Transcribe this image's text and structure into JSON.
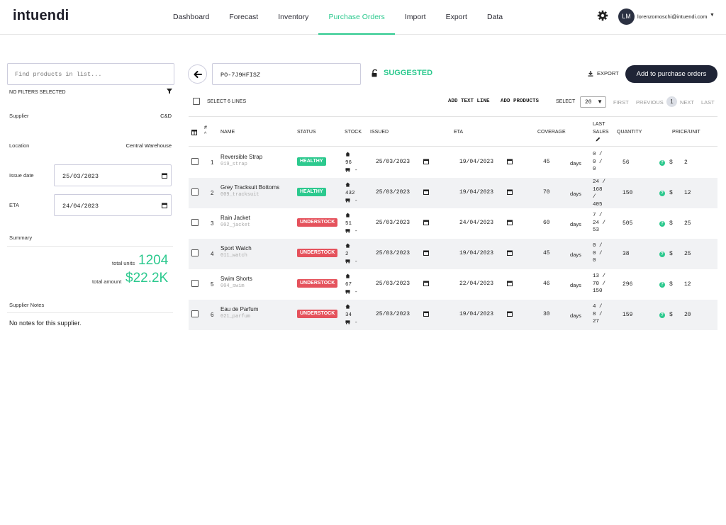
{
  "app": {
    "logo": "intuendi"
  },
  "nav": {
    "items": [
      {
        "label": "Dashboard"
      },
      {
        "label": "Forecast"
      },
      {
        "label": "Inventory"
      },
      {
        "label": "Purchase Orders",
        "active": true
      },
      {
        "label": "Import"
      },
      {
        "label": "Export"
      },
      {
        "label": "Data"
      }
    ]
  },
  "user": {
    "initials": "LM",
    "email": "lorenzomoschi@intuendi.com"
  },
  "left": {
    "find_placeholder": "Find products in list...",
    "filters_label": "NO FILTERS SELECTED",
    "supplier_label": "Supplier",
    "supplier_value": "C&D",
    "location_label": "Location",
    "location_value": "Central Warehouse",
    "issue_label": "Issue date",
    "issue_value": "25/03/2023",
    "eta_label": "ETA",
    "eta_value": "24/04/2023",
    "summary_label": "Summary",
    "total_units_label": "total units",
    "total_units_value": "1204",
    "total_amount_label": "total amount",
    "total_amount_value": "$22.2K",
    "notes_label": "Supplier Notes",
    "notes_value": "No notes for this supplier."
  },
  "header": {
    "po_value": "PO-7J9HFISZ",
    "status": "SUGGESTED",
    "export_label": "EXPORT",
    "add_button": "Add to purchase orders"
  },
  "toolbar": {
    "select_lines": "SELECT 6 LINES",
    "add_text_line": "ADD TEXT LINE",
    "add_products": "ADD PRODUCTS",
    "select_label": "SELECT",
    "page_size": "20",
    "first": "FIRST",
    "previous": "PREVIOUS",
    "page": "1",
    "next": "NEXT",
    "last": "LAST"
  },
  "table": {
    "headers": {
      "num": "#",
      "name": "NAME",
      "status": "STATUS",
      "stock": "STOCK",
      "issued": "ISSUED",
      "eta": "ETA",
      "coverage": "COVERAGE",
      "last_sales_1": "LAST",
      "last_sales_2": "SALES",
      "quantity": "QUANTITY",
      "price": "PRICE/UNIT"
    },
    "days_label": "days",
    "currency": "$",
    "rows": [
      {
        "n": "1",
        "name": "Reversible Strap",
        "sku": "019_strap",
        "status": "HEALTHY",
        "stock": "96",
        "incoming": "-",
        "issued": "25/03/2023",
        "eta": "19/04/2023",
        "coverage": "45",
        "sales": [
          "0 /",
          "0 /",
          "0"
        ],
        "qty": "56",
        "price": "2"
      },
      {
        "n": "2",
        "name": "Grey Tracksuit Bottoms",
        "sku": "009_tracksuit",
        "status": "HEALTHY",
        "stock": "432",
        "incoming": "-",
        "issued": "25/03/2023",
        "eta": "19/04/2023",
        "coverage": "70",
        "sales": [
          "24 /",
          "168",
          "/",
          "405"
        ],
        "qty": "150",
        "price": "12"
      },
      {
        "n": "3",
        "name": "Rain Jacket",
        "sku": "002_jacket",
        "status": "UNDERSTOCK",
        "stock": "51",
        "incoming": "-",
        "issued": "25/03/2023",
        "eta": "24/04/2023",
        "coverage": "60",
        "sales": [
          "7 /",
          "24 /",
          "53"
        ],
        "qty": "505",
        "price": "25"
      },
      {
        "n": "4",
        "name": "Sport Watch",
        "sku": "011_watch",
        "status": "UNDERSTOCK",
        "stock": "2",
        "incoming": "-",
        "issued": "25/03/2023",
        "eta": "19/04/2023",
        "coverage": "45",
        "sales": [
          "0 /",
          "0 /",
          "0"
        ],
        "qty": "38",
        "price": "25"
      },
      {
        "n": "5",
        "name": "Swim Shorts",
        "sku": "004_swim",
        "status": "UNDERSTOCK",
        "stock": "67",
        "incoming": "-",
        "issued": "25/03/2023",
        "eta": "22/04/2023",
        "coverage": "46",
        "sales": [
          "13 /",
          "70 /",
          "150"
        ],
        "qty": "296",
        "price": "12"
      },
      {
        "n": "6",
        "name": "Eau de Parfum",
        "sku": "021_parfum",
        "status": "UNDERSTOCK",
        "stock": "34",
        "incoming": "-",
        "issued": "25/03/2023",
        "eta": "19/04/2023",
        "coverage": "30",
        "sales": [
          "4 /",
          "8 /",
          "27"
        ],
        "qty": "159",
        "price": "20"
      }
    ]
  },
  "colors": {
    "accent": "#2cc98e",
    "danger": "#e5525c",
    "dark": "#1f2436"
  }
}
